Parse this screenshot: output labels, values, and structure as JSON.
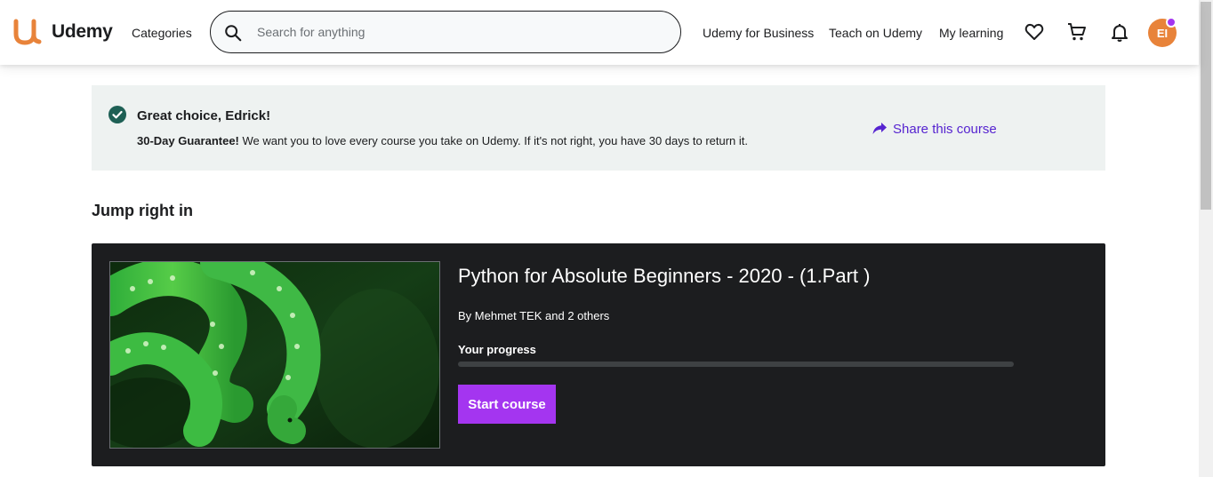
{
  "header": {
    "logo_text": "Udemy",
    "categories_label": "Categories",
    "search_placeholder": "Search for anything",
    "business_label": "Udemy for Business",
    "teach_label": "Teach on Udemy",
    "my_learning_label": "My learning",
    "wishlist_icon": "heart-icon",
    "cart_icon": "cart-icon",
    "notifications_icon": "bell-icon",
    "avatar_initials": "EI"
  },
  "banner": {
    "title": "Great choice, Edrick!",
    "guarantee_bold": "30-Day Guarantee!",
    "guarantee_text": " We want you to love every course you take on Udemy. If it's not right, you have 30 days to return it.",
    "share_label": "Share this course"
  },
  "section": {
    "title": "Jump right in"
  },
  "course": {
    "title": "Python for Absolute Beginners - 2020 - (1.Part )",
    "author": "By Mehmet TEK and 2 others",
    "progress_label": "Your progress",
    "progress_percent": 0,
    "start_label": "Start course"
  },
  "colors": {
    "brand": "#a435f0",
    "link": "#5624d0",
    "success": "#1e6055",
    "logo_orange": "#ec5252"
  }
}
